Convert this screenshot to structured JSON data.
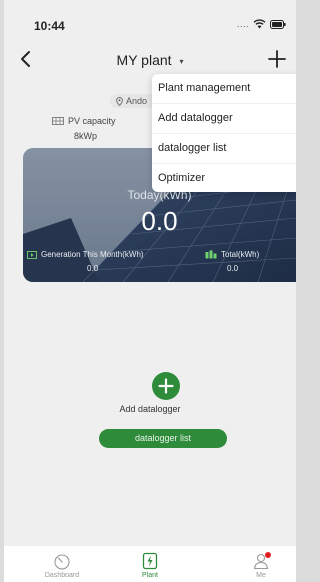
{
  "status_bar": {
    "time": "10:44",
    "signal_dots": "....",
    "wifi_icon": "wifi-icon",
    "battery_icon": "battery-icon"
  },
  "nav": {
    "title": "MY plant",
    "title_caret": "▾",
    "back_icon": "back-chevron-icon",
    "add_icon": "plus-icon"
  },
  "plant": {
    "location": "Ando",
    "pv_capacity_label": "PV capacity",
    "pv_capacity_value": "8kWp",
    "today_label": "Today(kWh)",
    "today_value": "0.0",
    "generation_month_label": "Generation This Month(kWh)",
    "generation_month_value": "0.0",
    "total_label": "Total(kWh)",
    "total_value": "0.0"
  },
  "menu": {
    "items": [
      {
        "label": "Plant management"
      },
      {
        "label": "Add datalogger"
      },
      {
        "label": "datalogger list"
      },
      {
        "label": "Optimizer"
      }
    ]
  },
  "empty_state": {
    "add_label": "Add datalogger",
    "list_button_label": "datalogger list"
  },
  "tabbar": {
    "tabs": [
      {
        "label": "Dashboard",
        "icon": "dashboard-gauge-icon",
        "active": false
      },
      {
        "label": "Plant",
        "icon": "plant-bolt-icon",
        "active": true
      },
      {
        "label": "Me",
        "icon": "person-icon",
        "active": false
      }
    ],
    "notification_dot": true
  },
  "colors": {
    "accent_green": "#2e8b3a",
    "tab_active": "#2e8b3a",
    "tab_inactive": "#999999",
    "badge_red": "#e02020"
  }
}
